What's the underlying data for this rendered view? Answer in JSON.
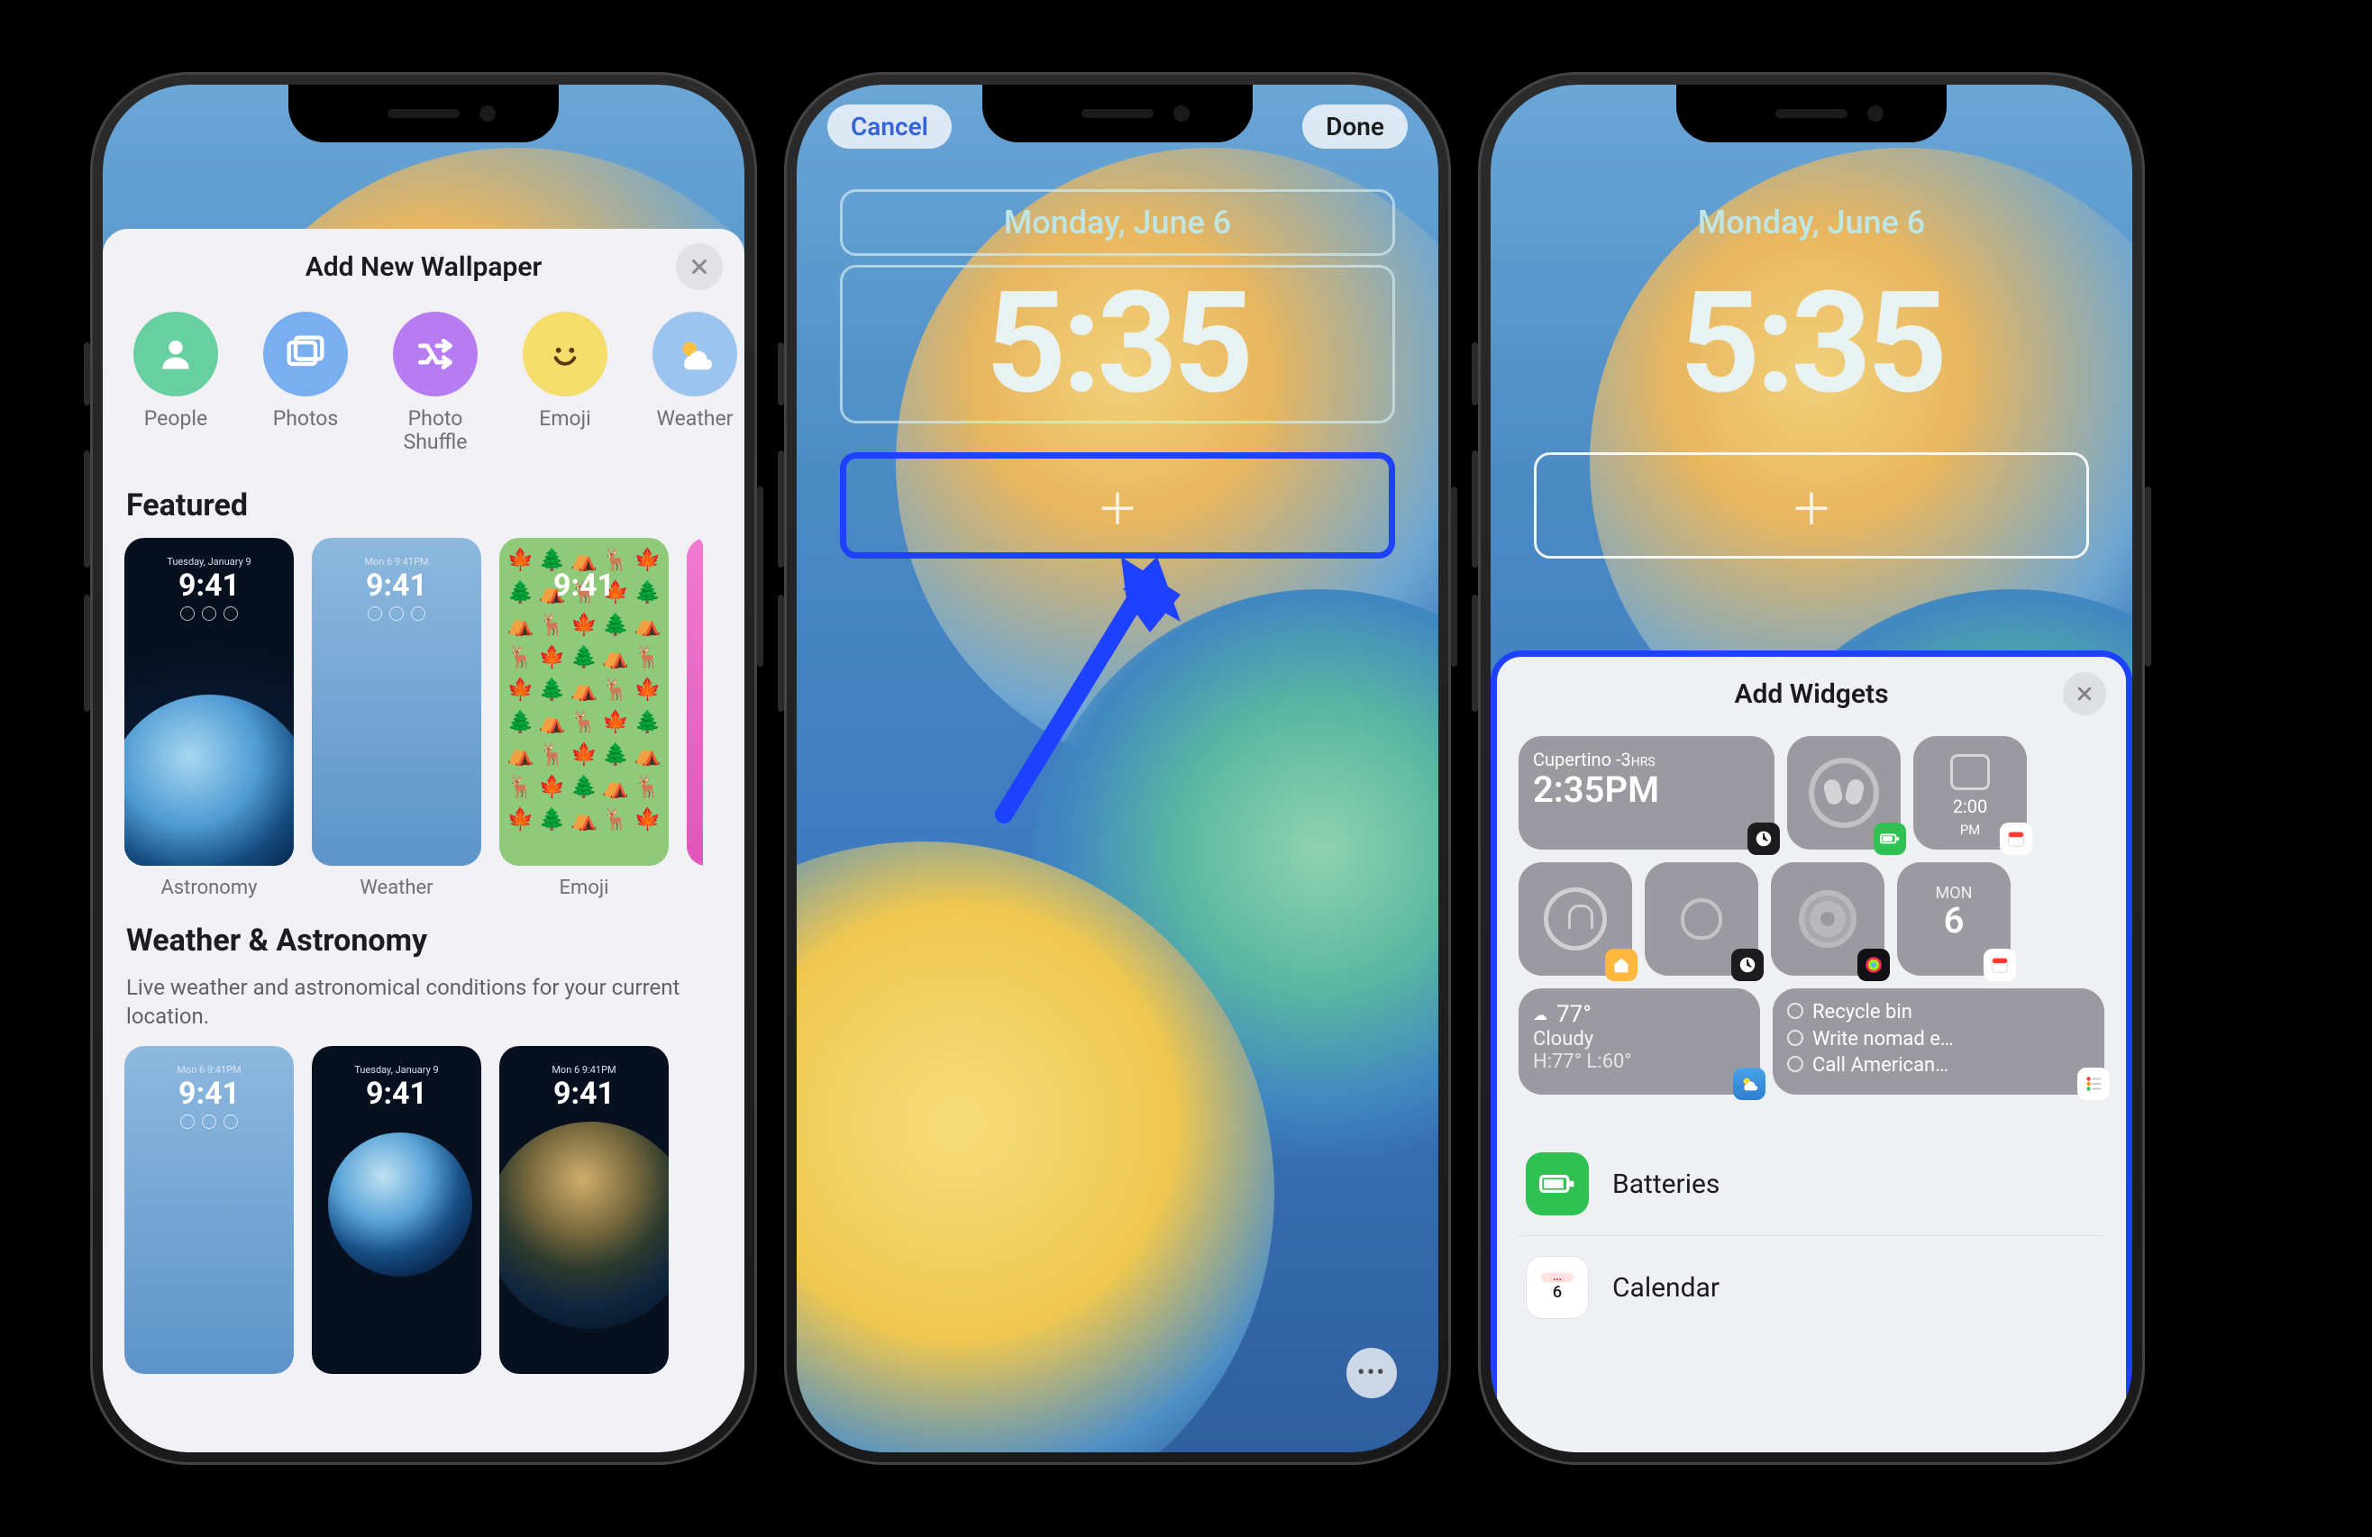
{
  "phone1": {
    "sheet_title": "Add New Wallpaper",
    "categories": [
      {
        "label": "People",
        "color": "#67cfa0",
        "icon": "person"
      },
      {
        "label": "Photos",
        "color": "#79aef1",
        "icon": "photos"
      },
      {
        "label": "Photo Shuffle",
        "color": "#b77cf1",
        "icon": "shuffle"
      },
      {
        "label": "Emoji",
        "color": "#f4dd6a",
        "icon": "emoji"
      },
      {
        "label": "Weather",
        "color": "#9cc4f0",
        "icon": "weather"
      }
    ],
    "featured_title": "Featured",
    "featured": [
      {
        "caption": "Astronomy",
        "kind": "astronomy",
        "date": "Tuesday, January 9",
        "time": "9:41"
      },
      {
        "caption": "Weather",
        "kind": "weather",
        "date": "Mon 6  9:41PM",
        "time": "9:41"
      },
      {
        "caption": "Emoji",
        "kind": "emoji",
        "date": "",
        "time": "9:41"
      },
      {
        "caption": "",
        "kind": "pink",
        "date": "",
        "time": ""
      }
    ],
    "section2_title": "Weather & Astronomy",
    "section2_sub": "Live weather and astronomical conditions for your current location.",
    "section2_row": [
      {
        "kind": "weather",
        "date": "Mon 6  9:41PM",
        "time": "9:41"
      },
      {
        "kind": "earth2",
        "date": "Tuesday, January 9",
        "time": "9:41"
      },
      {
        "kind": "earth3",
        "date": "Mon 6  9:41PM",
        "time": "9:41"
      }
    ]
  },
  "lock": {
    "date": "Monday, June 6",
    "time": "5:35",
    "cancel": "Cancel",
    "done": "Done"
  },
  "phone3": {
    "sheet_title": "Add Widgets",
    "world": {
      "city": "Cupertino",
      "offset": "-3",
      "offset_unit": "HRS",
      "time": "2:35PM"
    },
    "cal_small": {
      "time": "2:00",
      "ampm": "PM"
    },
    "cal_day": {
      "dow": "MON",
      "day": "6"
    },
    "weather": {
      "temp": "77°",
      "cond": "Cloudy",
      "hl": "H:77° L:60°"
    },
    "notes": {
      "l1": "Recycle bin",
      "l2": "Write nomad e…",
      "l3": "Call American…"
    },
    "apps": [
      {
        "label": "Batteries",
        "kind": "bat"
      },
      {
        "label": "Calendar",
        "kind": "cal"
      }
    ]
  }
}
